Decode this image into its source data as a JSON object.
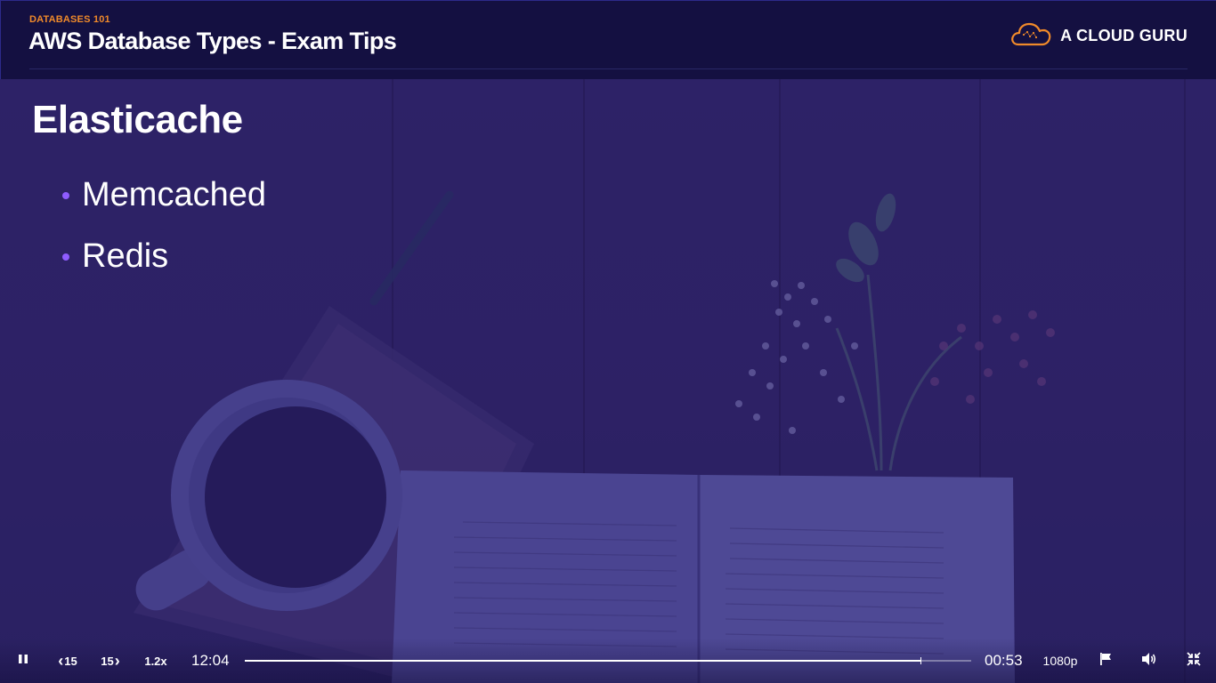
{
  "header": {
    "course_label": "DATABASES 101",
    "title": "AWS Database Types - Exam Tips",
    "brand_name": "A CLOUD GURU",
    "brand_icon": "cloud-logo-icon",
    "accent_color": "#f08a2a"
  },
  "slide": {
    "heading": "Elasticache",
    "bullets": [
      {
        "label": "Memcached"
      },
      {
        "label": "Redis"
      }
    ],
    "bullet_color": "#8f5cff"
  },
  "player": {
    "play_pause_icon": "pause-icon",
    "rewind_label": "15",
    "forward_label": "15",
    "speed_label": "1.2x",
    "elapsed": "12:04",
    "remaining": "00:53",
    "quality_label": "1080p",
    "progress_fraction": 0.93,
    "flag_icon": "flag-icon",
    "volume_icon": "volume-icon",
    "exit_fullscreen_icon": "exit-fullscreen-icon"
  }
}
